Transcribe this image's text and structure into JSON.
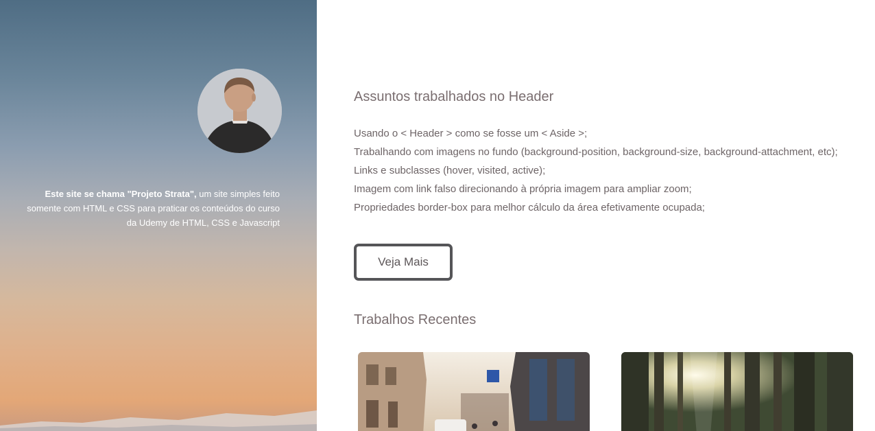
{
  "header": {
    "intro_bold": "Este site se chama \"Projeto Strata\",",
    "intro_text": " um site simples feito somente com HTML e CSS para praticar os conteúdos do curso da Udemy de HTML, CSS e Javascript",
    "avatar_icon": "person-back-photo"
  },
  "main": {
    "section1_title": "Assuntos trabalhados no Header",
    "topics": [
      "Usando o < Header > como se fosse um < Aside >;",
      "Trabalhando com imagens no fundo (background-position, background-size, background-attachment, etc);",
      "Links e subclasses (hover, visited, active);",
      "Imagem com link falso direcionando à própria imagem para ampliar zoom;",
      "Propriedades border-box para melhor cálculo da área efetivamente ocupada;"
    ],
    "more_button_label": "Veja Mais",
    "section2_title": "Trabalhos Recentes",
    "works": [
      {
        "icon": "city-street-photo"
      },
      {
        "icon": "forest-sunlight-photo"
      }
    ]
  },
  "colors": {
    "title_text": "#7a6e70",
    "body_text": "#6d6466",
    "button_border": "#555558",
    "header_sky_top": "#4f6d84",
    "header_sky_bottom": "#e3a777"
  }
}
